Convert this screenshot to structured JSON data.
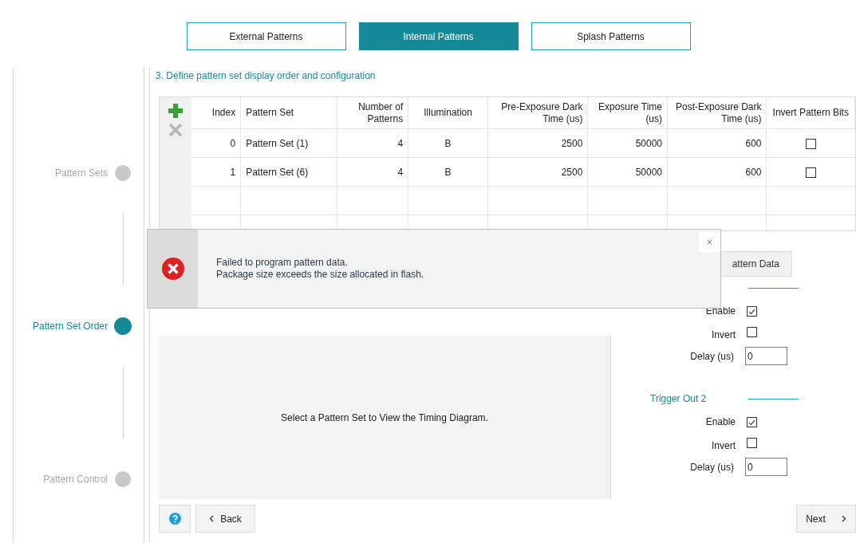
{
  "tabs": [
    {
      "label": "External Patterns",
      "selected": false
    },
    {
      "label": "Internal Patterns",
      "selected": true
    },
    {
      "label": "Splash Patterns",
      "selected": false
    }
  ],
  "steps": [
    {
      "label": "Pattern Sets",
      "selected": false
    },
    {
      "label": "Pattern Set Order",
      "selected": true
    },
    {
      "label": "Pattern Control",
      "selected": false
    }
  ],
  "section_heading": "3. Define pattern set display order and configuration",
  "toolbar": [
    {
      "kind": "add",
      "disabled": false
    },
    {
      "kind": "remove",
      "disabled": true
    }
  ],
  "table": {
    "columns": [
      "Index",
      "Pattern Set",
      "Number of Patterns",
      "Illumination",
      "Pre-Exposure Dark Time (us)",
      "Exposure Time (us)",
      "Post-Exposure Dark Time (us)",
      "Invert Pattern Bits"
    ],
    "rows": [
      {
        "cells": [
          "0",
          "Pattern Set (1)",
          "4",
          "B",
          "2500",
          "50000",
          "600"
        ],
        "invert_pattern_bits": false
      },
      {
        "cells": [
          "1",
          "Pattern Set (6)",
          "4",
          "B",
          "2500",
          "50000",
          "600"
        ],
        "invert_pattern_bits": false
      }
    ]
  },
  "program_button": "attern Data",
  "triggers": [
    {
      "enable_label": "Enable",
      "enable": true,
      "invert_label": "Invert",
      "invert": false,
      "delay_label": "Delay (us)",
      "delay": "0"
    },
    {
      "title": "Trigger Out 2",
      "enable_label": "Enable",
      "enable": true,
      "invert_label": "Invert",
      "invert": false,
      "delay_label": "Delay (us)",
      "delay": "0"
    }
  ],
  "timing_diagram": {
    "message": "Select a Pattern Set to View the Timing Diagram."
  },
  "nav": {
    "back": "Back",
    "next": "Next"
  },
  "toast": {
    "lines": [
      "Failed to program pattern data.",
      "Package size exceeds the size allocated in flash."
    ],
    "close": "×"
  }
}
